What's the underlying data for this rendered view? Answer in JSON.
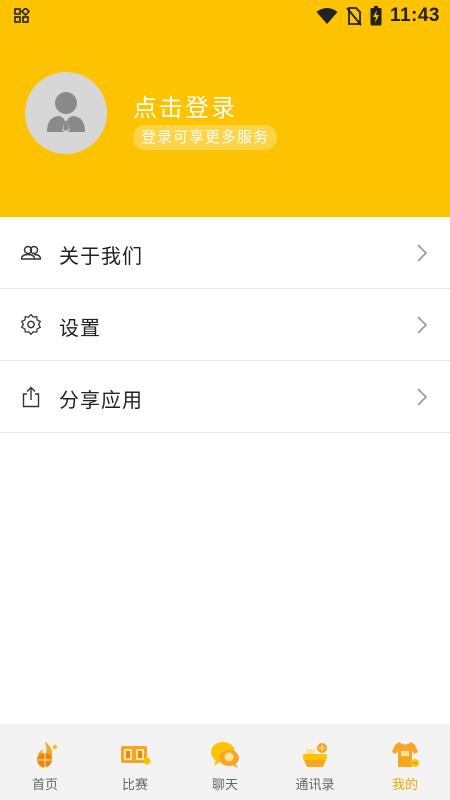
{
  "status_bar": {
    "time": "11:43"
  },
  "profile": {
    "login_title": "点击登录",
    "login_subtitle": "登录可享更多服务"
  },
  "menu": {
    "items": [
      {
        "label": "关于我们",
        "icon": "people-icon"
      },
      {
        "label": "设置",
        "icon": "gear-icon"
      },
      {
        "label": "分享应用",
        "icon": "share-icon"
      }
    ]
  },
  "tabbar": {
    "items": [
      {
        "label": "首页",
        "icon": "home-basketball-icon"
      },
      {
        "label": "比赛",
        "icon": "scoreboard-icon"
      },
      {
        "label": "聊天",
        "icon": "chat-bubbles-icon"
      },
      {
        "label": "通讯录",
        "icon": "contacts-icon"
      },
      {
        "label": "我的",
        "icon": "jersey-icon"
      }
    ],
    "active_index": 4
  },
  "colors": {
    "header_bg": "#FDC300",
    "tab_active": "#E7A900",
    "tab_inactive": "#666666"
  }
}
